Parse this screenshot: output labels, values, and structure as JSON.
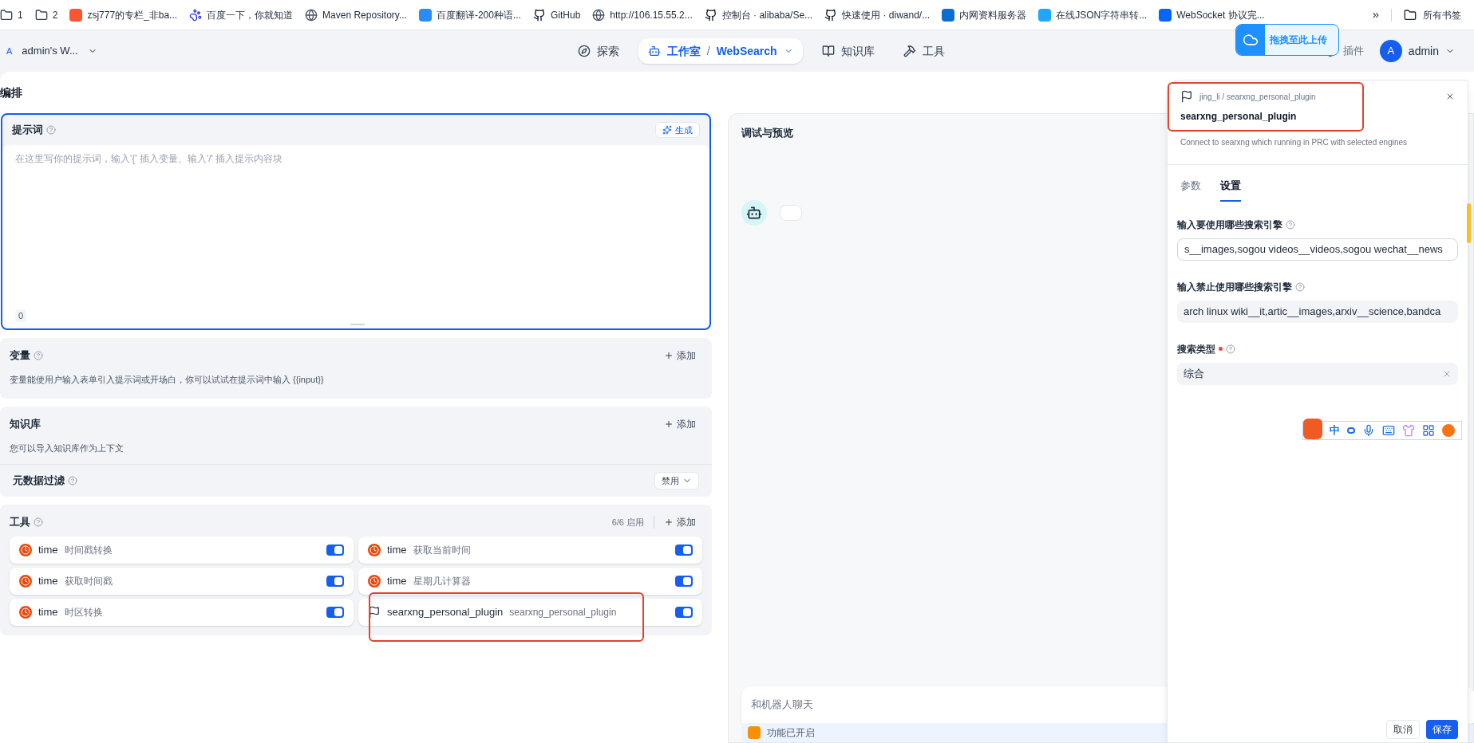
{
  "bookmarks": [
    {
      "label": "1"
    },
    {
      "label": "2"
    },
    {
      "label": "zsj777的专栏_非ba..."
    },
    {
      "label": "百度一下，你就知道"
    },
    {
      "label": "Maven Repository..."
    },
    {
      "label": "百度翻译-200种语..."
    },
    {
      "label": "GitHub"
    },
    {
      "label": "http://106.15.55.2..."
    },
    {
      "label": "控制台 · alibaba/Se..."
    },
    {
      "label": "快速使用 · diwand/..."
    },
    {
      "label": "内网资料服务器"
    },
    {
      "label": "在线JSON字符串转..."
    },
    {
      "label": "WebSocket 协议完..."
    }
  ],
  "bookmarks_overflow": "»",
  "all_bookmarks": "所有书签",
  "nav": {
    "workspace_avatar": "A",
    "workspace": "admin's W...",
    "tabs": [
      {
        "label": "探索",
        "selected": false
      },
      {
        "label": "工作室",
        "separator": "/",
        "sub": "WebSearch",
        "selected": true
      },
      {
        "label": "知识库",
        "selected": false
      },
      {
        "label": "工具",
        "selected": false
      }
    ],
    "plugin": "插件",
    "user_avatar": "A",
    "user": "admin"
  },
  "upload_overlay": "拖拽至此上传",
  "orchestration": {
    "title": "编排",
    "prompt": {
      "title": "提示词",
      "generate": "生成",
      "placeholder": "在这里写你的提示词，输入'{' 插入变量、输入'/' 插入提示内容块",
      "count": "0"
    },
    "variables": {
      "title": "变量",
      "add": "添加",
      "description": "变量能使用户输入表单引入提示词或开场白，你可以试试在提示词中输入 {{input}}"
    },
    "knowledge": {
      "title": "知识库",
      "add": "添加",
      "description": "您可以导入知识库作为上下文",
      "metadata_label": "元数据过滤",
      "metadata_value": "禁用"
    },
    "tools": {
      "title": "工具",
      "count": "6/6 启用",
      "add": "添加",
      "items": [
        {
          "kind": "clock",
          "provider": "time",
          "name": "时间戳转换",
          "on": true,
          "highlighted": false
        },
        {
          "kind": "clock",
          "provider": "time",
          "name": "获取当前时间",
          "on": true,
          "highlighted": false
        },
        {
          "kind": "clock",
          "provider": "time",
          "name": "获取时间戳",
          "on": true,
          "highlighted": false
        },
        {
          "kind": "clock",
          "provider": "time",
          "name": "星期几计算器",
          "on": true,
          "highlighted": false
        },
        {
          "kind": "clock",
          "provider": "time",
          "name": "时区转换",
          "on": true,
          "highlighted": false
        },
        {
          "kind": "flag",
          "provider": "searxng_personal_plugin",
          "name": "searxng_personal_plugin",
          "on": true,
          "highlighted": true
        }
      ]
    }
  },
  "debug": {
    "title": "调试与预览",
    "chat_placeholder": "和机器人聊天",
    "feature": "功能已开启"
  },
  "drawer": {
    "breadcrumb": "jing_li / searxng_personal_plugin",
    "title": "searxng_personal_plugin",
    "description": "Connect to searxng which running in PRC with selected engines",
    "highlighted": true,
    "tabs": [
      {
        "label": "参数",
        "selected": false
      },
      {
        "label": "设置",
        "selected": true
      }
    ],
    "fields": [
      {
        "label": "输入要使用哪些搜索引擎",
        "required": false,
        "kind": "input",
        "value": "s__images,sogou videos__videos,sogou wechat__news"
      },
      {
        "label": "输入禁止使用哪些搜索引擎",
        "required": false,
        "kind": "filled",
        "value": "arch linux wiki__it,artic__images,arxiv__science,bandca"
      },
      {
        "label": "搜索类型",
        "required": true,
        "kind": "select",
        "value": "综合"
      }
    ],
    "cancel": "取消",
    "save": "保存"
  },
  "ime": {
    "mode": "中"
  }
}
